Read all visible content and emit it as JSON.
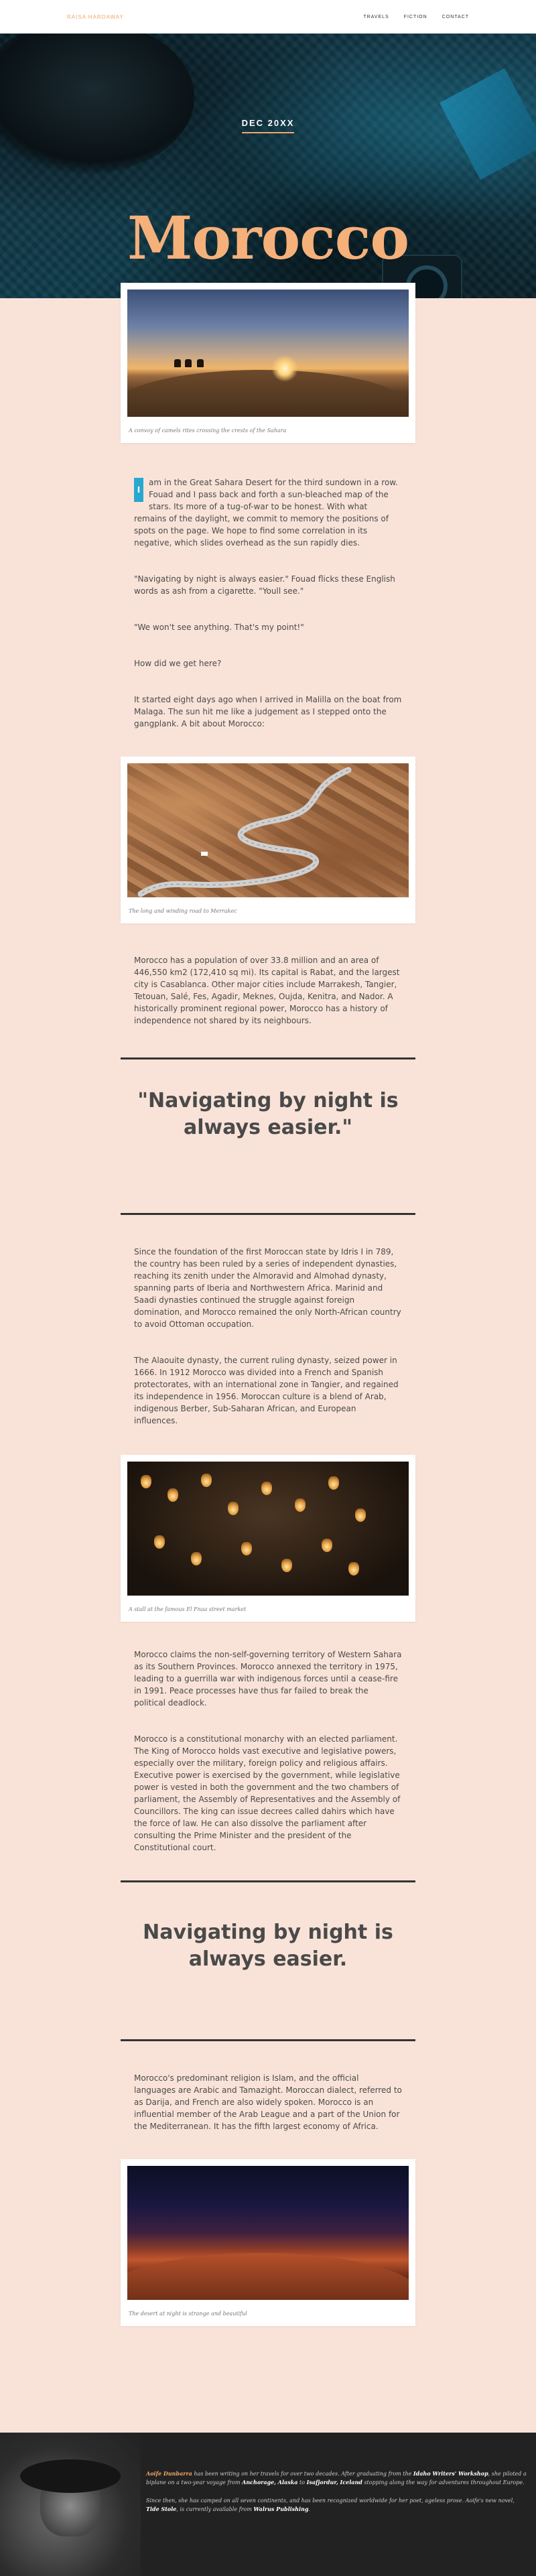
{
  "nav": {
    "brand": "RAISA HARDAWAY",
    "links": [
      "TRAVELS",
      "FICTION",
      "CONTACT"
    ]
  },
  "hero": {
    "date": "DEC 20XX",
    "title": "Morocco"
  },
  "figures": [
    {
      "caption": "A convoy of camels rites crossing the crests of the Sahara"
    },
    {
      "caption": "The long and winding road to Merrakec"
    },
    {
      "caption": "A stall at the famous El Fnaa street market"
    },
    {
      "caption": "The desert at night is strange and beautiful"
    }
  ],
  "article": {
    "dropcap": "I",
    "p1": "am in the Great Sahara Desert for the third sundown in a row. Fouad and I pass back and forth a sun-bleached map of the stars. Its more of a tug-of-war to be honest. With what remains of the daylight, we commit to memory the positions of spots on the page. We hope to find some correlation in its negative, which slides overhead as the sun rapidly dies.",
    "p2": "\"Navigating by night is always easier.\" Fouad flicks these English words as ash from a cigarette. \"Youll see.\"",
    "p3": "\"We won't see anything. That's my point!\"",
    "p4": "How did we get here?",
    "p5": "It started eight days ago when I arrived in Malilla on the boat from Malaga. The sun hit me like a judgement as I stepped onto the gangplank. A bit about Morocco:",
    "p6": "Morocco has a population of over 33.8 million and an area of 446,550 km2 (172,410 sq mi). Its capital is Rabat, and the largest city is Casablanca. Other major cities include Marrakesh, Tangier, Tetouan, Salé, Fes, Agadir, Meknes, Oujda, Kenitra, and Nador. A historically prominent regional power, Morocco has a history of independence not shared by its neighbours.",
    "pull1": "\"Navigating by night is always easier.\"",
    "p7": "Since the foundation of the first Moroccan state by Idris I in 789, the country has been ruled by a series of independent dynasties, reaching its zenith under the Almoravid and Almohad dynasty, spanning parts of Iberia and Northwestern Africa. Marinid and Saadi dynasties continued the struggle against foreign domination, and Morocco remained the only North-African country to avoid Ottoman occupation.",
    "p8": "The Alaouite dynasty, the current ruling dynasty, seized power in 1666. In 1912 Morocco was divided into a French and Spanish protectorates, with an international zone in Tangier, and regained its independence in 1956. Moroccan culture is a blend of Arab, indigenous Berber, Sub-Saharan African, and European influences.",
    "p9": "Morocco claims the non-self-governing territory of Western Sahara as its Southern Provinces. Morocco annexed the territory in 1975, leading to a guerrilla war with indigenous forces until a cease-fire in 1991. Peace processes have thus far failed to break the political deadlock.",
    "p10": "Morocco is a constitutional monarchy with an elected parliament. The King of Morocco holds vast executive and legislative powers, especially over the military, foreign policy and religious affairs. Executive power is exercised by the government, while legislative power is vested in both the government and the two chambers of parliament, the Assembly of Representatives and the Assembly of Councillors. The king can issue decrees called dahirs which have the force of law. He can also dissolve the parliament after consulting the Prime Minister and the president of the Constitutional court.",
    "pull2": "Navigating by night is always easier.",
    "p11": "Morocco's predominant religion is Islam, and the official languages are Arabic and Tamazight. Moroccan dialect, referred to as Darija, and French are also widely spoken. Morocco is an influential member of the Arab League and a part of the Union for the Mediterranean. It has the fifth largest economy of Africa."
  },
  "footer": {
    "author": "Aoife Dunbarra",
    "t1": " has been writing on her travels for over two decades. After graduating from the ",
    "workshop": "Idaho Writers' Workshop",
    "t2": ", she piloted a biplane on a two-year voyage from ",
    "from": "Anchorage, Alaska",
    "t3": " to ",
    "to": "Isafjordur, Iceland",
    "t4": " stopping along the way for adventures throughout Europe.",
    "p2a": "Since then, she has camped on all seven continents, and has been recognized worldwide for her poet, ageless prose. Aoife's new novel, ",
    "novel": "Tide Stole",
    "p2b": ", is currently available from ",
    "publisher": "Walrus Publishing",
    "p2c": "."
  }
}
